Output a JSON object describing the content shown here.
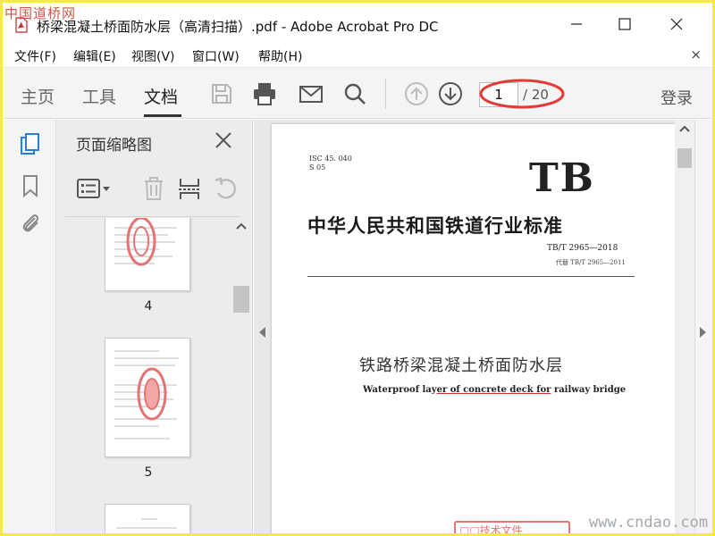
{
  "watermark": {
    "top_text": "中国道桥网",
    "bottom_text": "www.cndao.com"
  },
  "window": {
    "title": "桥梁混凝土桥面防水层（高清扫描）.pdf - Adobe Acrobat Pro DC"
  },
  "menu": {
    "items": [
      {
        "label": "文件(F)"
      },
      {
        "label": "编辑(E)"
      },
      {
        "label": "视图(V)"
      },
      {
        "label": "窗口(W)"
      },
      {
        "label": "帮助(H)"
      }
    ],
    "close_glyph": "×"
  },
  "toolbar": {
    "tabs": [
      {
        "label": "主页",
        "active": false
      },
      {
        "label": "工具",
        "active": false
      },
      {
        "label": "文档",
        "active": true
      }
    ],
    "icons": [
      "save-icon",
      "print-icon",
      "email-icon",
      "search-icon",
      "page-up-icon",
      "page-down-icon"
    ],
    "current_page": "1",
    "total_pages": "/ 20",
    "login_label": "登录",
    "highlight_color": "#e53935"
  },
  "left_rail": {
    "icons": [
      "page-thumbnails-icon",
      "bookmark-icon",
      "attachment-icon"
    ],
    "accent": "#2b7fd6"
  },
  "thumbnail_panel": {
    "title": "页面缩略图",
    "tools": [
      "thumbnail-options-icon",
      "delete-page-icon",
      "extract-page-icon",
      "rotate-page-icon"
    ],
    "thumbnails": [
      {
        "page_label": "4"
      },
      {
        "page_label": "5"
      },
      {
        "page_label": ""
      }
    ]
  },
  "document": {
    "meta_ics": "ISC 45. 040",
    "meta_s": "S 05",
    "logo": "TB",
    "standard_title": "中华人民共和国铁道行业标准",
    "code": "TB/T 2965—2018",
    "replaces": "代替 TB/T 2965—2011",
    "title_cn": "铁路桥梁混凝土桥面防水层",
    "title_en_parts": [
      "Waterproof lay",
      "er of concrete deck for",
      " railway bridge"
    ],
    "stamp_text": "□□技术文件"
  }
}
